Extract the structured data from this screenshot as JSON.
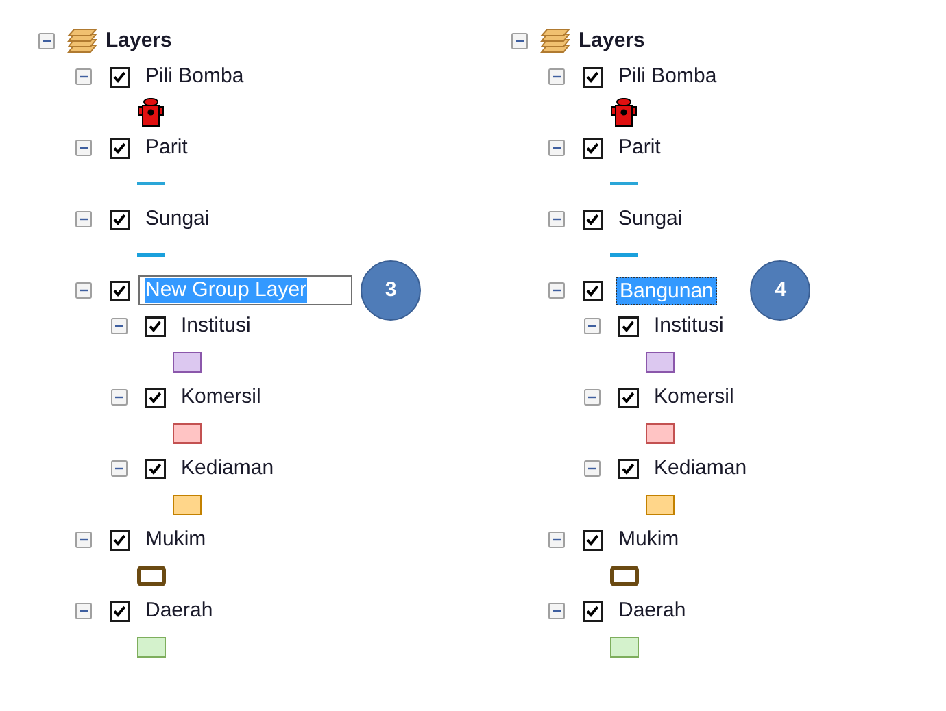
{
  "panels": [
    {
      "root": {
        "label": "Layers",
        "expanded": true
      },
      "callout": "3",
      "layers": [
        {
          "name": "Pili Bomba",
          "expanded": true,
          "checked": true,
          "selected": false,
          "editing": false,
          "symbol": {
            "kind": "hydrant"
          }
        },
        {
          "name": "Parit",
          "expanded": true,
          "checked": true,
          "selected": false,
          "editing": false,
          "symbol": {
            "kind": "line",
            "color": "#2aa6d8"
          }
        },
        {
          "name": "Sungai",
          "expanded": true,
          "checked": true,
          "selected": false,
          "editing": false,
          "symbol": {
            "kind": "thick-line",
            "color": "#1aa0dc"
          }
        },
        {
          "name": "New Group Layer",
          "expanded": true,
          "checked": true,
          "selected": true,
          "editing": true,
          "children": [
            {
              "name": "Institusi",
              "expanded": true,
              "checked": true,
              "selected": false,
              "editing": false,
              "symbol": {
                "kind": "fill",
                "color": "#dcc8f0"
              }
            },
            {
              "name": "Komersil",
              "expanded": true,
              "checked": true,
              "selected": false,
              "editing": false,
              "symbol": {
                "kind": "fill",
                "color": "#ffc4c4"
              }
            },
            {
              "name": "Kediaman",
              "expanded": true,
              "checked": true,
              "selected": false,
              "editing": false,
              "symbol": {
                "kind": "fill",
                "color": "#ffd68a"
              }
            }
          ]
        },
        {
          "name": "Mukim",
          "expanded": true,
          "checked": true,
          "selected": false,
          "editing": false,
          "symbol": {
            "kind": "outline",
            "color": "#6b4a12"
          }
        },
        {
          "name": "Daerah",
          "expanded": true,
          "checked": true,
          "selected": false,
          "editing": false,
          "symbol": {
            "kind": "fill",
            "color": "#d4f2cc"
          }
        }
      ]
    },
    {
      "root": {
        "label": "Layers",
        "expanded": true
      },
      "callout": "4",
      "layers": [
        {
          "name": "Pili Bomba",
          "expanded": true,
          "checked": true,
          "selected": false,
          "editing": false,
          "symbol": {
            "kind": "hydrant"
          }
        },
        {
          "name": "Parit",
          "expanded": true,
          "checked": true,
          "selected": false,
          "editing": false,
          "symbol": {
            "kind": "line",
            "color": "#2aa6d8"
          }
        },
        {
          "name": "Sungai",
          "expanded": true,
          "checked": true,
          "selected": false,
          "editing": false,
          "symbol": {
            "kind": "thick-line",
            "color": "#1aa0dc"
          }
        },
        {
          "name": "Bangunan",
          "expanded": true,
          "checked": true,
          "selected": true,
          "editing": false,
          "children": [
            {
              "name": "Institusi",
              "expanded": true,
              "checked": true,
              "selected": false,
              "editing": false,
              "symbol": {
                "kind": "fill",
                "color": "#dcc8f0"
              }
            },
            {
              "name": "Komersil",
              "expanded": true,
              "checked": true,
              "selected": false,
              "editing": false,
              "symbol": {
                "kind": "fill",
                "color": "#ffc4c4"
              }
            },
            {
              "name": "Kediaman",
              "expanded": true,
              "checked": true,
              "selected": false,
              "editing": false,
              "symbol": {
                "kind": "fill",
                "color": "#ffd68a"
              }
            }
          ]
        },
        {
          "name": "Mukim",
          "expanded": true,
          "checked": true,
          "selected": false,
          "editing": false,
          "symbol": {
            "kind": "outline",
            "color": "#6b4a12"
          }
        },
        {
          "name": "Daerah",
          "expanded": true,
          "checked": true,
          "selected": false,
          "editing": false,
          "symbol": {
            "kind": "fill",
            "color": "#d4f2cc"
          }
        }
      ]
    }
  ]
}
